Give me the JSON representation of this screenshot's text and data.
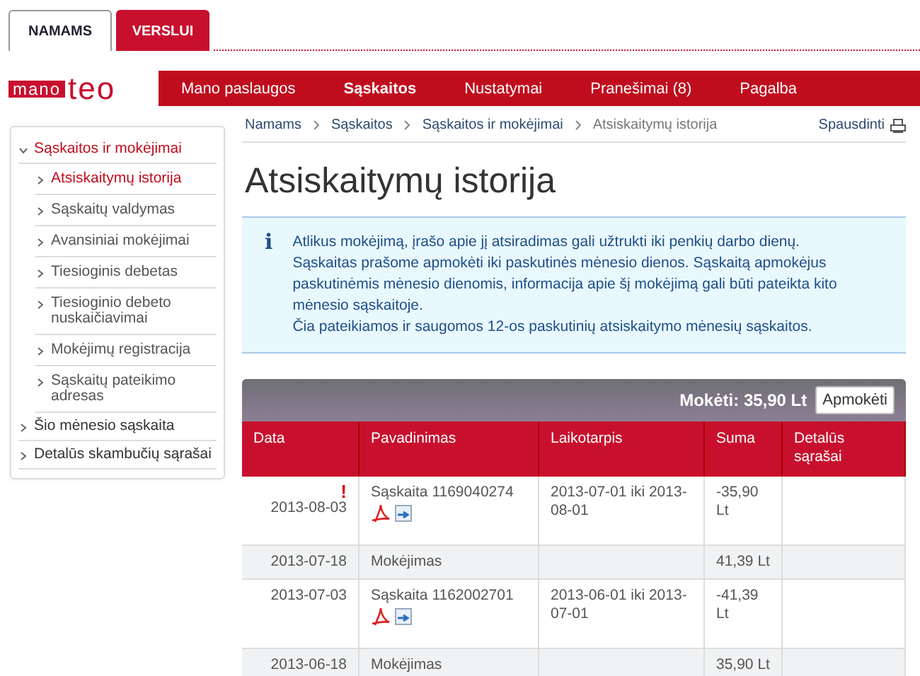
{
  "top_tabs": [
    {
      "label": "NAMAMS",
      "selected": true
    },
    {
      "label": "VERSLUI",
      "selected": false
    }
  ],
  "logo": {
    "boxed": "mano",
    "text": "teo"
  },
  "nav": [
    {
      "label": "Mano paslaugos",
      "selected": false
    },
    {
      "label": "Sąskaitos",
      "selected": true
    },
    {
      "label": "Nustatymai",
      "selected": false
    },
    {
      "label": "Pranešimai (8)",
      "selected": false
    },
    {
      "label": "Pagalba",
      "selected": false
    }
  ],
  "sidebar": {
    "items": [
      {
        "label": "Sąskaitos ir mokėjimai",
        "expanded": true,
        "selected": false,
        "children": [
          {
            "label": "Atsiskaitymų istorija",
            "selected": true
          },
          {
            "label": "Sąskaitų valdymas",
            "selected": false
          },
          {
            "label": "Avansiniai mokėjimai",
            "selected": false
          },
          {
            "label": "Tiesioginis debetas",
            "selected": false
          },
          {
            "label": "Tiesioginio debeto nuskaičiavimai",
            "selected": false
          },
          {
            "label": "Mokėjimų registracija",
            "selected": false
          },
          {
            "label": "Sąskaitų pateikimo adresas",
            "selected": false
          }
        ]
      },
      {
        "label": "Šio mėnesio sąskaita",
        "expanded": false,
        "selected": false
      },
      {
        "label": "Detalūs skambučių sąrašai",
        "expanded": false,
        "selected": false
      }
    ]
  },
  "breadcrumb": [
    "Namams",
    "Sąskaitos",
    "Sąskaitos ir mokėjimai",
    "Atsiskaitymų istorija"
  ],
  "print_link": "Spausdinti",
  "title": "Atsiskaitymų istorija",
  "info": {
    "icon": "i",
    "lines": [
      "Atlikus mokėjimą, įrašo apie jį atsiradimas gali užtrukti iki penkių darbo dienų. Sąskaitas prašome apmokėti iki paskutinės mėnesio dienos. Sąskaitą apmokėjus paskutinėmis mėnesio dienomis, informacija apie šį mokėjimą gali būti pateikta kito mėnesio sąskaitoje.",
      "Čia pateikiamos ir saugomos 12-os paskutinių atsiskaitymo mėnesių sąskaitos."
    ]
  },
  "table": {
    "pay_label": "Mokėti: 35,90 Lt",
    "pay_button": "Apmokėti",
    "columns": [
      "Data",
      "Pavadinimas",
      "Laikotarpis",
      "Suma",
      "Detalūs sąrašai"
    ],
    "rows": [
      {
        "date": "2013-08-03",
        "alert": "!",
        "name": "Sąskaita 1169040274",
        "files": true,
        "period": "2013-07-01 iki 2013-08-01",
        "sum": "-35,90 Lt"
      },
      {
        "date": "2013-07-18",
        "name": "Mokėjimas",
        "files": false,
        "period": "",
        "sum": "41,39 Lt"
      },
      {
        "date": "2013-07-03",
        "name": "Sąskaita 1162002701",
        "files": true,
        "period": "2013-06-01 iki 2013-07-01",
        "sum": "-41,39 Lt"
      },
      {
        "date": "2013-06-18",
        "name": "Mokėjimas",
        "files": false,
        "period": "",
        "sum": "35,90 Lt"
      }
    ]
  }
}
